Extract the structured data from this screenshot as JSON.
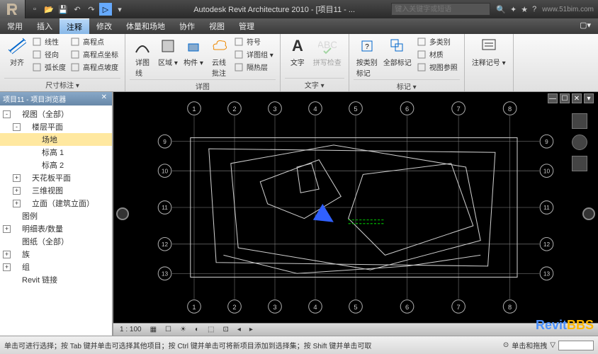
{
  "title": "Autodesk Revit Architecture 2010 - [项目11 - ...",
  "search_placeholder": "键入关键字或短语",
  "watermark_url": "www.51bim.com",
  "menu": {
    "items": [
      "常用",
      "插入",
      "注释",
      "修改",
      "体量和场地",
      "协作",
      "视图",
      "管理"
    ],
    "active_index": 2
  },
  "ribbon": {
    "panels": [
      {
        "title": "尺寸标注 ▾",
        "big": [
          {
            "label": "对齐",
            "icon": "dim-align"
          }
        ],
        "small_cols": [
          [
            {
              "label": "线性",
              "icon": "dim-linear"
            },
            {
              "label": "径向",
              "icon": "dim-radial"
            },
            {
              "label": "弧长度",
              "icon": "dim-arc"
            }
          ],
          [
            {
              "label": "高程点",
              "icon": "spot-elev"
            },
            {
              "label": "高程点坐标",
              "icon": "spot-coord"
            },
            {
              "label": "高程点坡度",
              "icon": "spot-slope"
            }
          ]
        ]
      },
      {
        "title": "详图",
        "big": [
          {
            "label": "详图\n线",
            "icon": "detail-line"
          },
          {
            "label": "区域",
            "icon": "region",
            "dd": true
          },
          {
            "label": "构件",
            "icon": "component",
            "dd": true
          },
          {
            "label": "云线\n批注",
            "icon": "cloud"
          }
        ],
        "small_cols": [
          [
            {
              "label": "符号",
              "icon": "symbol"
            },
            {
              "label": "详图组",
              "icon": "group",
              "dd": true
            },
            {
              "label": "隔热层",
              "icon": "insul"
            }
          ]
        ]
      },
      {
        "title": "文字 ▾",
        "big": [
          {
            "label": "文字",
            "icon": "text-A"
          },
          {
            "label": "拼写检查",
            "icon": "spell",
            "disabled": true
          }
        ]
      },
      {
        "title": "标记 ▾",
        "big": [
          {
            "label": "按类别\n标记",
            "icon": "tag-cat"
          },
          {
            "label": "全部标记",
            "icon": "tag-all"
          }
        ],
        "small_cols": [
          [
            {
              "label": "多类别",
              "icon": "multi"
            },
            {
              "label": "材质",
              "icon": "material"
            },
            {
              "label": "视图参照",
              "icon": "viewref"
            }
          ]
        ]
      },
      {
        "title": "",
        "big": [
          {
            "label": "注释记号",
            "icon": "keynote",
            "dd": true
          }
        ]
      }
    ]
  },
  "browser": {
    "title": "项目11 - 项目浏览器",
    "tree": [
      {
        "lvl": 0,
        "exp": "-",
        "icon": "views",
        "label": "视图（全部）"
      },
      {
        "lvl": 1,
        "exp": "-",
        "icon": "",
        "label": "楼层平面"
      },
      {
        "lvl": 2,
        "exp": "",
        "icon": "",
        "label": "场地",
        "sel": true
      },
      {
        "lvl": 2,
        "exp": "",
        "icon": "",
        "label": "标高 1"
      },
      {
        "lvl": 2,
        "exp": "",
        "icon": "",
        "label": "标高 2"
      },
      {
        "lvl": 1,
        "exp": "+",
        "icon": "",
        "label": "天花板平面"
      },
      {
        "lvl": 1,
        "exp": "+",
        "icon": "",
        "label": "三维视图"
      },
      {
        "lvl": 1,
        "exp": "+",
        "icon": "",
        "label": "立面（建筑立面）"
      },
      {
        "lvl": 0,
        "exp": "",
        "icon": "legend",
        "label": "图例"
      },
      {
        "lvl": 0,
        "exp": "+",
        "icon": "sched",
        "label": "明细表/数量"
      },
      {
        "lvl": 0,
        "exp": "",
        "icon": "sheet",
        "label": "图纸（全部）"
      },
      {
        "lvl": 0,
        "exp": "+",
        "icon": "fam",
        "label": "族"
      },
      {
        "lvl": 0,
        "exp": "+",
        "icon": "grp",
        "label": "组"
      },
      {
        "lvl": 0,
        "exp": "",
        "icon": "link",
        "label": "Revit 链接"
      }
    ]
  },
  "grids": {
    "cols": [
      1,
      2,
      3,
      4,
      5,
      6,
      7,
      8
    ],
    "rows": [
      9,
      10,
      11,
      12,
      13
    ]
  },
  "viewbar": {
    "scale": "1 : 100"
  },
  "status": {
    "text": "单击可进行选择；按 Tab 键并单击可选择其他项目；按 Ctrl 键并单击可将新项目添加到选择集；按 Shift 键并单击可取",
    "right": "单击和拖拽"
  },
  "logo": {
    "p1": "Revit",
    "p2": "BBS"
  }
}
